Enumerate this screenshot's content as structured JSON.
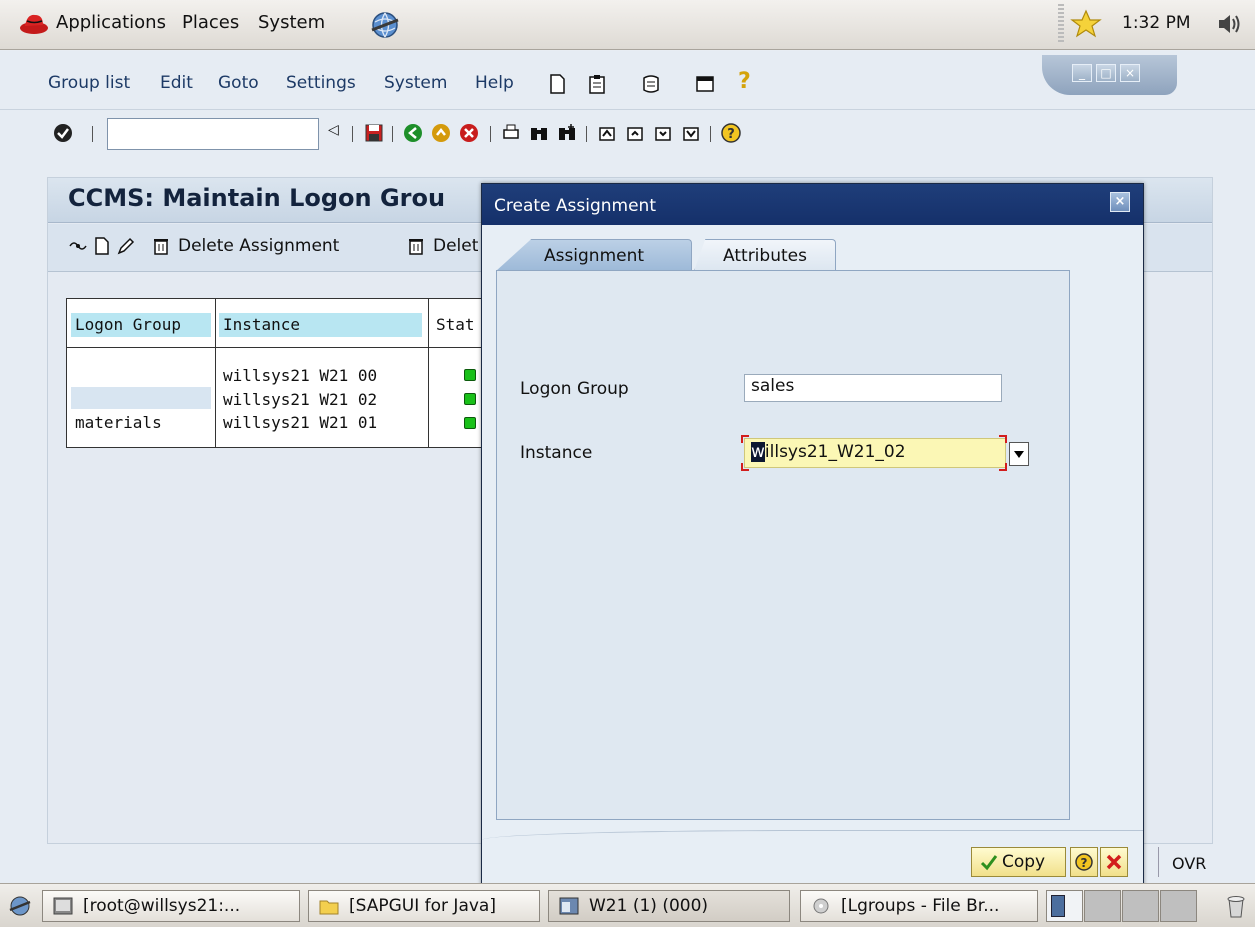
{
  "top_panel": {
    "menus": [
      "Applications",
      "Places",
      "System"
    ],
    "clock": "1:32 PM"
  },
  "sap": {
    "menu": [
      "Group list",
      "Edit",
      "Goto",
      "Settings",
      "System",
      "Help"
    ],
    "command_field_value": "",
    "page_title": "CCMS: Maintain Logon Grou",
    "app_toolbar": {
      "delete_assignment": "Delete Assignment",
      "delete_truncated": "Delet"
    },
    "table": {
      "headers": [
        "Logon Group",
        "Instance",
        "Stat"
      ],
      "rows": [
        {
          "group": "",
          "instance": "willsys21 W21 00"
        },
        {
          "group": "",
          "instance": "willsys21 W21 02"
        },
        {
          "group": "materials",
          "instance": "willsys21 W21 01"
        }
      ]
    },
    "status_mode": "OVR"
  },
  "dialog": {
    "title": "Create Assignment",
    "tabs": [
      "Assignment",
      "Attributes"
    ],
    "active_tab": "Assignment",
    "logon_group_label": "Logon Group",
    "logon_group_value": "sales",
    "instance_label": "Instance",
    "instance_first_char": "w",
    "instance_rest": "illsys21_W21_02",
    "copy_label": "Copy"
  },
  "taskbar": {
    "tasks": [
      "[root@willsys21:...",
      "[SAPGUI for Java]",
      "W21 (1) (000)",
      "[Lgroups - File Br..."
    ]
  },
  "colors": {
    "sap_accent": "#15306a",
    "status_green": "#19c019",
    "required_red": "#d21d1d",
    "button_yellow": "#f1e08a"
  }
}
